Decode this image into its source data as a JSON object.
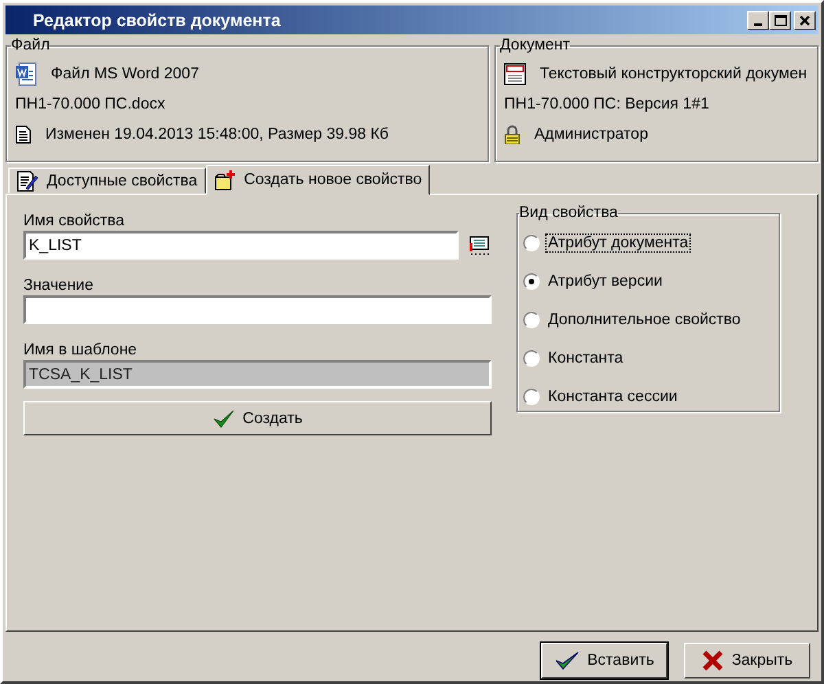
{
  "window": {
    "title": "Редактор свойств документа"
  },
  "file_group": {
    "title": "Файл",
    "type": "Файл MS Word 2007",
    "filename": "ПН1-70.000 ПС.docx",
    "modified": "Изменен 19.04.2013 15:48:00, Размер 39.98 Кб"
  },
  "document_group": {
    "title": "Документ",
    "type": "Текстовый конструкторский докумен",
    "version": "ПН1-70.000 ПС: Версия 1#1",
    "user": "Администратор"
  },
  "tabs": [
    {
      "label": "Доступные свойства",
      "selected": false,
      "kind": "list"
    },
    {
      "label": "Создать новое свойство",
      "selected": true,
      "kind": "new"
    }
  ],
  "form": {
    "fields": [
      {
        "label": "Имя свойства",
        "value": "K_LIST",
        "disabled": false,
        "kind": "picker"
      },
      {
        "label": "Значение",
        "disabled": false,
        "kind": "text"
      },
      {
        "label": "Имя в шаблоне",
        "value": "TCSA_K_LIST",
        "disabled": true,
        "kind": "text"
      }
    ],
    "create_button": "Создать"
  },
  "property_kind": {
    "title": "Вид свойства",
    "options": [
      {
        "label": "Атрибут документа",
        "selected": false,
        "focused": true
      },
      {
        "label": "Атрибут версии",
        "selected": true,
        "focused": false
      },
      {
        "label": "Дополнительное свойство",
        "selected": false,
        "focused": false
      },
      {
        "label": "Константа",
        "selected": false,
        "focused": false
      },
      {
        "label": "Константа сессии",
        "selected": false,
        "focused": false
      }
    ]
  },
  "buttons": [
    {
      "label": "Вставить",
      "kind": "ok"
    },
    {
      "label": "Закрыть",
      "kind": "close"
    }
  ]
}
